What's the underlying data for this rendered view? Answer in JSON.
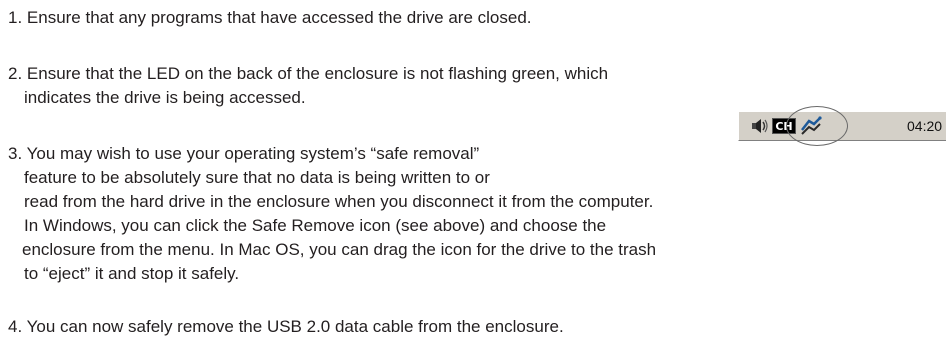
{
  "steps": [
    {
      "lines": [
        "1. Ensure that any programs that have accessed the drive are closed."
      ]
    },
    {
      "lines": [
        "2. Ensure that the LED on the back of the enclosure is not flashing green, which",
        "indicates the drive is being accessed."
      ]
    },
    {
      "lines": [
        "3. You may wish to use your operating system’s “safe removal”",
        "feature to be absolutely sure that no data is being written to or",
        "read from the hard drive in the enclosure when you disconnect it from the computer.",
        "In Windows, you can click the Safe Remove icon (see above) and choose the",
        "enclosure from the menu.  In Mac OS, you can drag the icon for the drive to the trash",
        "to “eject” it and stop it safely."
      ]
    },
    {
      "lines": [
        "4. You can now safely remove the USB 2.0 data cable from the enclosure."
      ]
    }
  ],
  "tray": {
    "language_badge": "CH",
    "clock": "04:20",
    "icons": [
      "speaker-icon",
      "safe-remove-icon"
    ]
  }
}
